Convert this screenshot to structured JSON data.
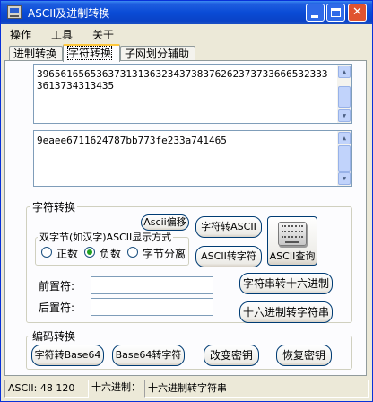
{
  "window": {
    "title": "ASCII及进制转换"
  },
  "menu": [
    "操作",
    "工具",
    "关于"
  ],
  "tabs": [
    "进制转换",
    "字符转换",
    "子网划分辅助"
  ],
  "text_top": "39656165653637313136323437383762623737336665323333613734313435",
  "text_bottom": "9eaee6711624787bb773fe233a741465",
  "char_group": {
    "legend": "字符转换",
    "ascii_shift_button": "Ascii偏移",
    "to_ascii_button": "字符转ASCII",
    "to_char_button": "ASCII转字符",
    "ascii_query_button": "ASCII查询",
    "display_mode": {
      "legend": "双字节(如汉字)ASCII显示方式",
      "options": [
        "正数",
        "负数",
        "字节分离"
      ],
      "selected": "负数"
    },
    "prefix_label": "前置符:",
    "prefix_value": "",
    "suffix_label": "后置符:",
    "suffix_value": "",
    "to_hex_button": "字符串转十六进制",
    "hex_to_string_button": "十六进制转字符串"
  },
  "encode_group": {
    "legend": "编码转换",
    "to_base64_button": "字符转Base64",
    "from_base64_button": "Base64转字符",
    "change_key_button": "改变密钥",
    "restore_key_button": "恢复密钥"
  },
  "status": {
    "ascii": "ASCII: 48 120",
    "hex_label": "十六进制：",
    "message": "十六进制转字符串"
  }
}
